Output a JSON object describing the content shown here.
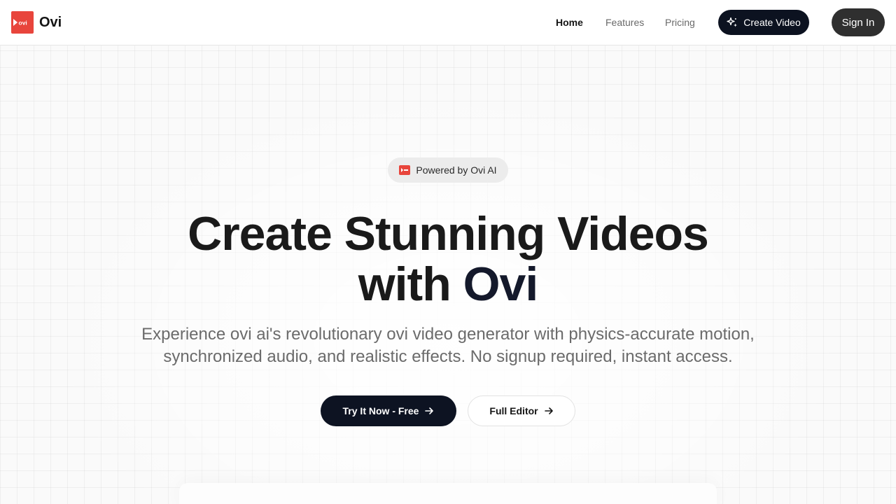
{
  "brand": {
    "name": "Ovi",
    "logo_text": "ovi",
    "accent_color": "#e8453c"
  },
  "nav": {
    "home": "Home",
    "features": "Features",
    "pricing": "Pricing",
    "create_video": "Create Video",
    "sign_in": "Sign In"
  },
  "hero": {
    "badge": "Powered by Ovi AI",
    "title_line1": "Create Stunning Videos",
    "title_line2_prefix": "with ",
    "title_line2_accent": "Ovi",
    "subtitle": "Experience ovi ai's revolutionary ovi video generator with physics-accurate motion, synchronized audio, and realistic effects. No signup required, instant access.",
    "primary_cta": "Try It Now - Free",
    "secondary_cta": "Full Editor"
  },
  "icons": {
    "create_video": "sparkles-icon",
    "cta_arrow": "arrow-right-icon"
  }
}
